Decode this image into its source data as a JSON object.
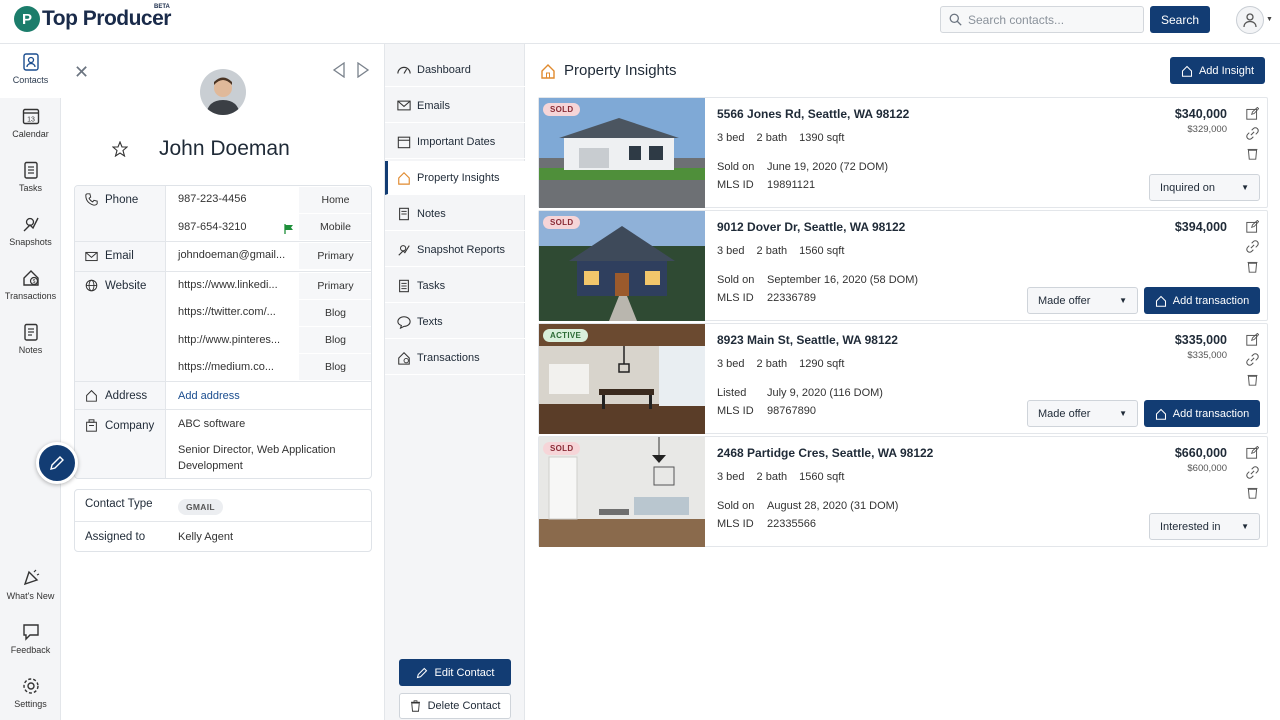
{
  "app": {
    "brand": "Top Producer",
    "brand_badge": "BETA",
    "search_placeholder": "Search contacts...",
    "search_button": "Search"
  },
  "leftnav": {
    "items": [
      {
        "label": "Contacts",
        "icon": "contacts-icon"
      },
      {
        "label": "Calendar",
        "icon": "calendar-icon",
        "day": "13"
      },
      {
        "label": "Tasks",
        "icon": "tasks-icon"
      },
      {
        "label": "Snapshots",
        "icon": "snapshots-icon"
      },
      {
        "label": "Transactions",
        "icon": "transactions-icon"
      },
      {
        "label": "Notes",
        "icon": "notes-icon"
      }
    ],
    "bottom": [
      {
        "label": "What's New",
        "icon": "whats-new-icon"
      },
      {
        "label": "Feedback",
        "icon": "feedback-icon"
      },
      {
        "label": "Settings",
        "icon": "settings-icon"
      }
    ]
  },
  "contact": {
    "name": "John Doeman",
    "labels": {
      "phone": "Phone",
      "email": "Email",
      "website": "Website",
      "address": "Address",
      "company": "Company",
      "contact_type": "Contact Type",
      "assigned_to": "Assigned to"
    },
    "phones": [
      {
        "value": "987-223-4456",
        "tag": "Home"
      },
      {
        "value": "987-654-3210",
        "tag": "Mobile"
      }
    ],
    "email": {
      "value": "johndoeman@gmail...",
      "tag": "Primary"
    },
    "websites": [
      {
        "value": "https://www.linkedi...",
        "tag": "Primary"
      },
      {
        "value": "https://twitter.com/...",
        "tag": "Blog"
      },
      {
        "value": "http://www.pinteres...",
        "tag": "Blog"
      },
      {
        "value": "https://medium.co...",
        "tag": "Blog"
      }
    ],
    "address_action": "Add address",
    "company_name": "ABC software",
    "company_title": "Senior Director, Web Application Development",
    "contact_type": "GMAIL",
    "assigned_to": "Kelly Agent"
  },
  "subnav": {
    "items": [
      {
        "label": "Dashboard"
      },
      {
        "label": "Emails"
      },
      {
        "label": "Important Dates"
      },
      {
        "label": "Property Insights"
      },
      {
        "label": "Notes"
      },
      {
        "label": "Snapshot Reports"
      },
      {
        "label": "Tasks"
      },
      {
        "label": "Texts"
      },
      {
        "label": "Transactions"
      }
    ],
    "active_index": 3,
    "edit_button": "Edit Contact",
    "delete_button": "Delete Contact"
  },
  "main": {
    "title": "Property Insights",
    "add_button": "Add Insight",
    "add_transaction_label": "Add transaction",
    "properties": [
      {
        "status": "SOLD",
        "address": "5566 Jones Rd, Seattle, WA 98122",
        "bed": "3 bed",
        "bath": "2 bath",
        "sqft": "1390 sqft",
        "date_label": "Sold on",
        "date": "June 19, 2020 (72 DOM)",
        "mls_label": "MLS ID",
        "mls": "19891121",
        "price": "$340,000",
        "orig_price": "$329,000",
        "select": "Inquired on",
        "show_tx": false
      },
      {
        "status": "SOLD",
        "address": "9012 Dover Dr, Seattle, WA 98122",
        "bed": "3 bed",
        "bath": "2 bath",
        "sqft": "1560 sqft",
        "date_label": "Sold on",
        "date": "September 16, 2020 (58 DOM)",
        "mls_label": "MLS ID",
        "mls": "22336789",
        "price": "$394,000",
        "orig_price": "",
        "select": "Made offer",
        "show_tx": true
      },
      {
        "status": "ACTIVE",
        "address": "8923 Main St, Seattle, WA 98122",
        "bed": "3 bed",
        "bath": "2 bath",
        "sqft": "1290 sqft",
        "date_label": "Listed",
        "date": "July 9, 2020 (116 DOM)",
        "mls_label": "MLS ID",
        "mls": "98767890",
        "price": "$335,000",
        "orig_price": "$335,000",
        "select": "Made offer",
        "show_tx": true
      },
      {
        "status": "SOLD",
        "address": "2468 Partidge Cres, Seattle, WA 98122",
        "bed": "3 bed",
        "bath": "2 bath",
        "sqft": "1560 sqft",
        "date_label": "Sold on",
        "date": "August 28, 2020 (31 DOM)",
        "mls_label": "MLS ID",
        "mls": "22335566",
        "price": "$660,000",
        "orig_price": "$600,000",
        "select": "Interested in",
        "show_tx": false
      }
    ]
  },
  "colors": {
    "primary": "#123c73",
    "brand_green": "#1c7d6b",
    "sold_badge": "#f6d5d8",
    "active_badge": "#d9f0dc"
  }
}
